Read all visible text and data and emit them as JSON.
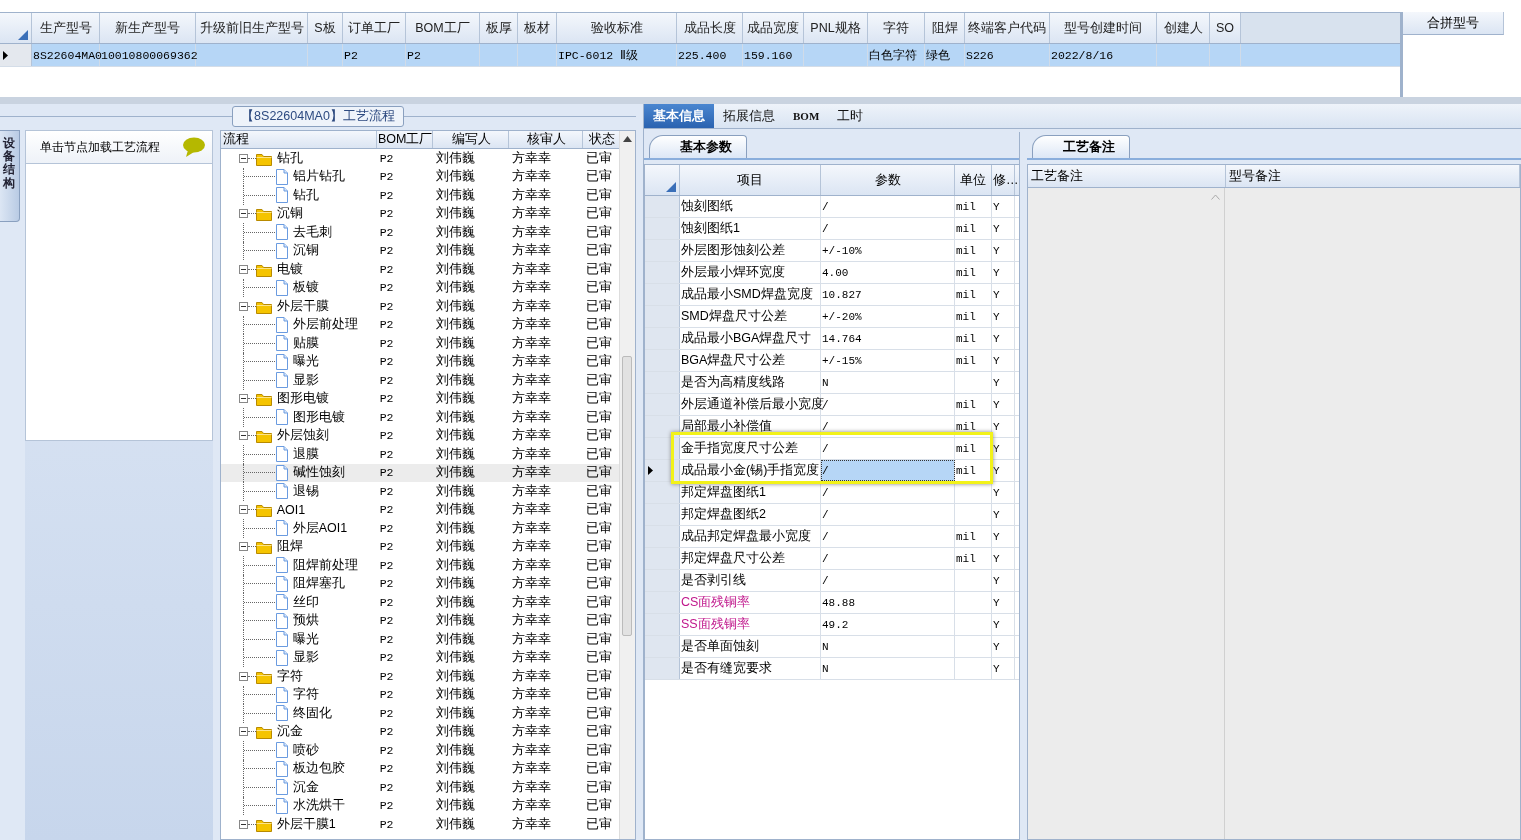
{
  "product_grid": {
    "columns": [
      "生产型号",
      "新生产型号",
      "升级前旧生产型号",
      "S板",
      "订单工厂",
      "BOM工厂",
      "板厚",
      "板材",
      "验收标准",
      "成品长度",
      "成品宽度",
      "PNL规格",
      "字符",
      "阻焊",
      "终端客户代码",
      "型号创建时间",
      "创建人",
      "SO"
    ],
    "rows": [
      {
        "selected": true,
        "cells": [
          "8S22604MA0",
          "10010800069362",
          null,
          null,
          "P2",
          "P2",
          null,
          null,
          "IPC-6012 Ⅱ级",
          "225.400",
          "159.160",
          null,
          "白色字符",
          "绿色",
          "S226",
          "2022/8/16",
          null,
          null
        ]
      }
    ],
    "merge_panel": {
      "header": "合拼型号"
    }
  },
  "flow_panel": {
    "title": "【8S22604MA0】工艺流程",
    "side_tab": "设备结构",
    "hint": "单击节点加载工艺流程",
    "columns": [
      "流程",
      "BOM工厂",
      "编写人",
      "核审人",
      "状态"
    ],
    "tree": [
      {
        "name": "钻孔",
        "bom": "P2",
        "writer": "刘伟巍",
        "reviewer": "方幸幸",
        "status": "已审",
        "selected": false,
        "expanded": true,
        "children": [
          {
            "name": "铝片钻孔",
            "bom": "P2",
            "writer": "刘伟巍",
            "reviewer": "方幸幸",
            "status": "已审",
            "selected": false
          },
          {
            "name": "钻孔",
            "bom": "P2",
            "writer": "刘伟巍",
            "reviewer": "方幸幸",
            "status": "已审",
            "selected": false
          }
        ]
      },
      {
        "name": "沉铜",
        "bom": "P2",
        "writer": "刘伟巍",
        "reviewer": "方幸幸",
        "status": "已审",
        "selected": false,
        "expanded": true,
        "children": [
          {
            "name": "去毛刺",
            "bom": "P2",
            "writer": "刘伟巍",
            "reviewer": "方幸幸",
            "status": "已审",
            "selected": false
          },
          {
            "name": "沉铜",
            "bom": "P2",
            "writer": "刘伟巍",
            "reviewer": "方幸幸",
            "status": "已审",
            "selected": false
          }
        ]
      },
      {
        "name": "电镀",
        "bom": "P2",
        "writer": "刘伟巍",
        "reviewer": "方幸幸",
        "status": "已审",
        "selected": false,
        "expanded": true,
        "children": [
          {
            "name": "板镀",
            "bom": "P2",
            "writer": "刘伟巍",
            "reviewer": "方幸幸",
            "status": "已审",
            "selected": false
          }
        ]
      },
      {
        "name": "外层干膜",
        "bom": "P2",
        "writer": "刘伟巍",
        "reviewer": "方幸幸",
        "status": "已审",
        "selected": false,
        "expanded": true,
        "children": [
          {
            "name": "外层前处理",
            "bom": "P2",
            "writer": "刘伟巍",
            "reviewer": "方幸幸",
            "status": "已审",
            "selected": false
          },
          {
            "name": "贴膜",
            "bom": "P2",
            "writer": "刘伟巍",
            "reviewer": "方幸幸",
            "status": "已审",
            "selected": false
          },
          {
            "name": "曝光",
            "bom": "P2",
            "writer": "刘伟巍",
            "reviewer": "方幸幸",
            "status": "已审",
            "selected": false
          },
          {
            "name": "显影",
            "bom": "P2",
            "writer": "刘伟巍",
            "reviewer": "方幸幸",
            "status": "已审",
            "selected": false
          }
        ]
      },
      {
        "name": "图形电镀",
        "bom": "P2",
        "writer": "刘伟巍",
        "reviewer": "方幸幸",
        "status": "已审",
        "selected": false,
        "expanded": true,
        "children": [
          {
            "name": "图形电镀",
            "bom": "P2",
            "writer": "刘伟巍",
            "reviewer": "方幸幸",
            "status": "已审",
            "selected": false
          }
        ]
      },
      {
        "name": "外层蚀刻",
        "bom": "P2",
        "writer": "刘伟巍",
        "reviewer": "方幸幸",
        "status": "已审",
        "selected": false,
        "expanded": true,
        "children": [
          {
            "name": "退膜",
            "bom": "P2",
            "writer": "刘伟巍",
            "reviewer": "方幸幸",
            "status": "已审",
            "selected": false
          },
          {
            "name": "碱性蚀刻",
            "bom": "P2",
            "writer": "刘伟巍",
            "reviewer": "方幸幸",
            "status": "已审",
            "selected": true
          },
          {
            "name": "退锡",
            "bom": "P2",
            "writer": "刘伟巍",
            "reviewer": "方幸幸",
            "status": "已审",
            "selected": false
          }
        ]
      },
      {
        "name": "AOI1",
        "bom": "P2",
        "writer": "刘伟巍",
        "reviewer": "方幸幸",
        "status": "已审",
        "selected": false,
        "expanded": true,
        "children": [
          {
            "name": "外层AOI1",
            "bom": "P2",
            "writer": "刘伟巍",
            "reviewer": "方幸幸",
            "status": "已审",
            "selected": false
          }
        ]
      },
      {
        "name": "阻焊",
        "bom": "P2",
        "writer": "刘伟巍",
        "reviewer": "方幸幸",
        "status": "已审",
        "selected": false,
        "expanded": true,
        "children": [
          {
            "name": "阻焊前处理",
            "bom": "P2",
            "writer": "刘伟巍",
            "reviewer": "方幸幸",
            "status": "已审",
            "selected": false
          },
          {
            "name": "阻焊塞孔",
            "bom": "P2",
            "writer": "刘伟巍",
            "reviewer": "方幸幸",
            "status": "已审",
            "selected": false
          },
          {
            "name": "丝印",
            "bom": "P2",
            "writer": "刘伟巍",
            "reviewer": "方幸幸",
            "status": "已审",
            "selected": false
          },
          {
            "name": "预烘",
            "bom": "P2",
            "writer": "刘伟巍",
            "reviewer": "方幸幸",
            "status": "已审",
            "selected": false
          },
          {
            "name": "曝光",
            "bom": "P2",
            "writer": "刘伟巍",
            "reviewer": "方幸幸",
            "status": "已审",
            "selected": false
          },
          {
            "name": "显影",
            "bom": "P2",
            "writer": "刘伟巍",
            "reviewer": "方幸幸",
            "status": "已审",
            "selected": false
          }
        ]
      },
      {
        "name": "字符",
        "bom": "P2",
        "writer": "刘伟巍",
        "reviewer": "方幸幸",
        "status": "已审",
        "selected": false,
        "expanded": true,
        "children": [
          {
            "name": "字符",
            "bom": "P2",
            "writer": "刘伟巍",
            "reviewer": "方幸幸",
            "status": "已审",
            "selected": false
          },
          {
            "name": "终固化",
            "bom": "P2",
            "writer": "刘伟巍",
            "reviewer": "方幸幸",
            "status": "已审",
            "selected": false
          }
        ]
      },
      {
        "name": "沉金",
        "bom": "P2",
        "writer": "刘伟巍",
        "reviewer": "方幸幸",
        "status": "已审",
        "selected": false,
        "expanded": true,
        "children": [
          {
            "name": "喷砂",
            "bom": "P2",
            "writer": "刘伟巍",
            "reviewer": "方幸幸",
            "status": "已审",
            "selected": false
          },
          {
            "name": "板边包胶",
            "bom": "P2",
            "writer": "刘伟巍",
            "reviewer": "方幸幸",
            "status": "已审",
            "selected": false
          },
          {
            "name": "沉金",
            "bom": "P2",
            "writer": "刘伟巍",
            "reviewer": "方幸幸",
            "status": "已审",
            "selected": false
          },
          {
            "name": "水洗烘干",
            "bom": "P2",
            "writer": "刘伟巍",
            "reviewer": "方幸幸",
            "status": "已审",
            "selected": false
          }
        ]
      },
      {
        "name": "外层干膜1",
        "bom": "P2",
        "writer": "刘伟巍",
        "reviewer": "方幸幸",
        "status": "已审",
        "selected": false,
        "expanded": true
      }
    ]
  },
  "info_panel": {
    "tabs": [
      {
        "label": "基本信息",
        "selected": true
      },
      {
        "label": "拓展信息",
        "selected": false
      },
      {
        "label": "BOM",
        "selected": false
      },
      {
        "label": "工时",
        "selected": false
      }
    ],
    "params": {
      "tab": "基本参数",
      "columns": [
        "项目",
        "参数",
        "单位",
        "修…"
      ],
      "rows": [
        {
          "item": "蚀刻图纸",
          "value": "/",
          "unit": "mil",
          "flag": "Y",
          "flagged": false,
          "selected": false,
          "highlighted": false
        },
        {
          "item": "蚀刻图纸1",
          "value": "/",
          "unit": "mil",
          "flag": "Y",
          "flagged": false,
          "selected": false,
          "highlighted": false
        },
        {
          "item": "外层图形蚀刻公差",
          "value": "+/-10%",
          "unit": "mil",
          "flag": "Y",
          "flagged": false,
          "selected": false,
          "highlighted": false
        },
        {
          "item": "外层最小焊环宽度",
          "value": "4.00",
          "unit": "mil",
          "flag": "Y",
          "flagged": false,
          "selected": false,
          "highlighted": false
        },
        {
          "item": "成品最小SMD焊盘宽度",
          "value": "10.827",
          "unit": "mil",
          "flag": "Y",
          "flagged": false,
          "selected": false,
          "highlighted": false
        },
        {
          "item": "SMD焊盘尺寸公差",
          "value": "+/-20%",
          "unit": "mil",
          "flag": "Y",
          "flagged": false,
          "selected": false,
          "highlighted": false
        },
        {
          "item": "成品最小BGA焊盘尺寸",
          "value": "14.764",
          "unit": "mil",
          "flag": "Y",
          "flagged": false,
          "selected": false,
          "highlighted": false
        },
        {
          "item": "BGA焊盘尺寸公差",
          "value": "+/-15%",
          "unit": "mil",
          "flag": "Y",
          "flagged": false,
          "selected": false,
          "highlighted": false
        },
        {
          "item": "是否为高精度线路",
          "value": "N",
          "flag": "Y",
          "flagged": false,
          "selected": false,
          "highlighted": false
        },
        {
          "item": "外层通道补偿后最小宽度",
          "value": "/",
          "unit": "mil",
          "flag": "Y",
          "flagged": false,
          "selected": false,
          "highlighted": false
        },
        {
          "item": "局部最小补偿值",
          "value": "/",
          "unit": "mil",
          "flag": "Y",
          "flagged": false,
          "selected": false,
          "highlighted": false
        },
        {
          "item": "金手指宽度尺寸公差",
          "value": "/",
          "unit": "mil",
          "flag": "Y",
          "flagged": false,
          "selected": false,
          "highlighted": true
        },
        {
          "item": "成品最小金(锡)手指宽度",
          "value": "/",
          "unit": "mil",
          "flag": "Y",
          "flagged": false,
          "selected": true,
          "highlighted": true
        },
        {
          "item": "邦定焊盘图纸1",
          "value": "/",
          "flag": "Y",
          "flagged": false,
          "selected": false,
          "highlighted": false
        },
        {
          "item": "邦定焊盘图纸2",
          "value": "/",
          "flag": "Y",
          "flagged": false,
          "selected": false,
          "highlighted": false
        },
        {
          "item": "成品邦定焊盘最小宽度",
          "value": "/",
          "unit": "mil",
          "flag": "Y",
          "flagged": false,
          "selected": false,
          "highlighted": false
        },
        {
          "item": "邦定焊盘尺寸公差",
          "value": "/",
          "unit": "mil",
          "flag": "Y",
          "flagged": false,
          "selected": false,
          "highlighted": false
        },
        {
          "item": "是否剥引线",
          "value": "/",
          "flag": "Y",
          "flagged": false,
          "selected": false,
          "highlighted": false
        },
        {
          "item": "CS面残铜率",
          "value": "48.88",
          "flag": "Y",
          "flagged": true,
          "selected": false,
          "highlighted": false
        },
        {
          "item": "SS面残铜率",
          "value": "49.2",
          "flag": "Y",
          "flagged": true,
          "selected": false,
          "highlighted": false
        },
        {
          "item": "是否单面蚀刻",
          "value": "N",
          "flag": "Y",
          "flagged": false,
          "selected": false,
          "highlighted": false
        },
        {
          "item": "是否有缝宽要求",
          "value": "N",
          "flag": "Y",
          "flagged": false,
          "selected": false,
          "highlighted": false
        }
      ]
    },
    "notes": {
      "tab": "工艺备注",
      "columns": [
        "工艺备注",
        "型号备注"
      ]
    }
  }
}
